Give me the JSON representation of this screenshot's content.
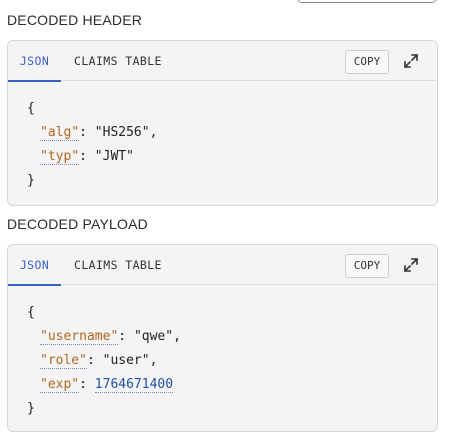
{
  "header_section": {
    "title": "DECODED HEADER",
    "tabs": [
      {
        "label": "JSON",
        "active": true
      },
      {
        "label": "CLAIMS TABLE",
        "active": false
      }
    ],
    "copy_label": "COPY",
    "json": {
      "open": "{",
      "close": "}",
      "entries": [
        {
          "key": "\"alg\"",
          "value": "\"HS256\"",
          "trail": ","
        },
        {
          "key": "\"typ\"",
          "value": "\"JWT\"",
          "trail": ""
        }
      ]
    }
  },
  "payload_section": {
    "title": "DECODED PAYLOAD",
    "tabs": [
      {
        "label": "JSON",
        "active": true
      },
      {
        "label": "CLAIMS TABLE",
        "active": false
      }
    ],
    "copy_label": "COPY",
    "json": {
      "open": "{",
      "close": "}",
      "entries": [
        {
          "key": "\"username\"",
          "value": "\"qwe\"",
          "trail": ","
        },
        {
          "key": "\"role\"",
          "value": "\"user\"",
          "trail": ","
        },
        {
          "key": "\"exp\"",
          "value": "1764671400",
          "trail": ""
        }
      ]
    }
  },
  "colors": {
    "accent": "#3b61c4",
    "key": "#b5651d",
    "number": "#1f4fa8",
    "panel_bg": "#f4f4f4"
  },
  "icons": {
    "expand": "expand-icon"
  }
}
